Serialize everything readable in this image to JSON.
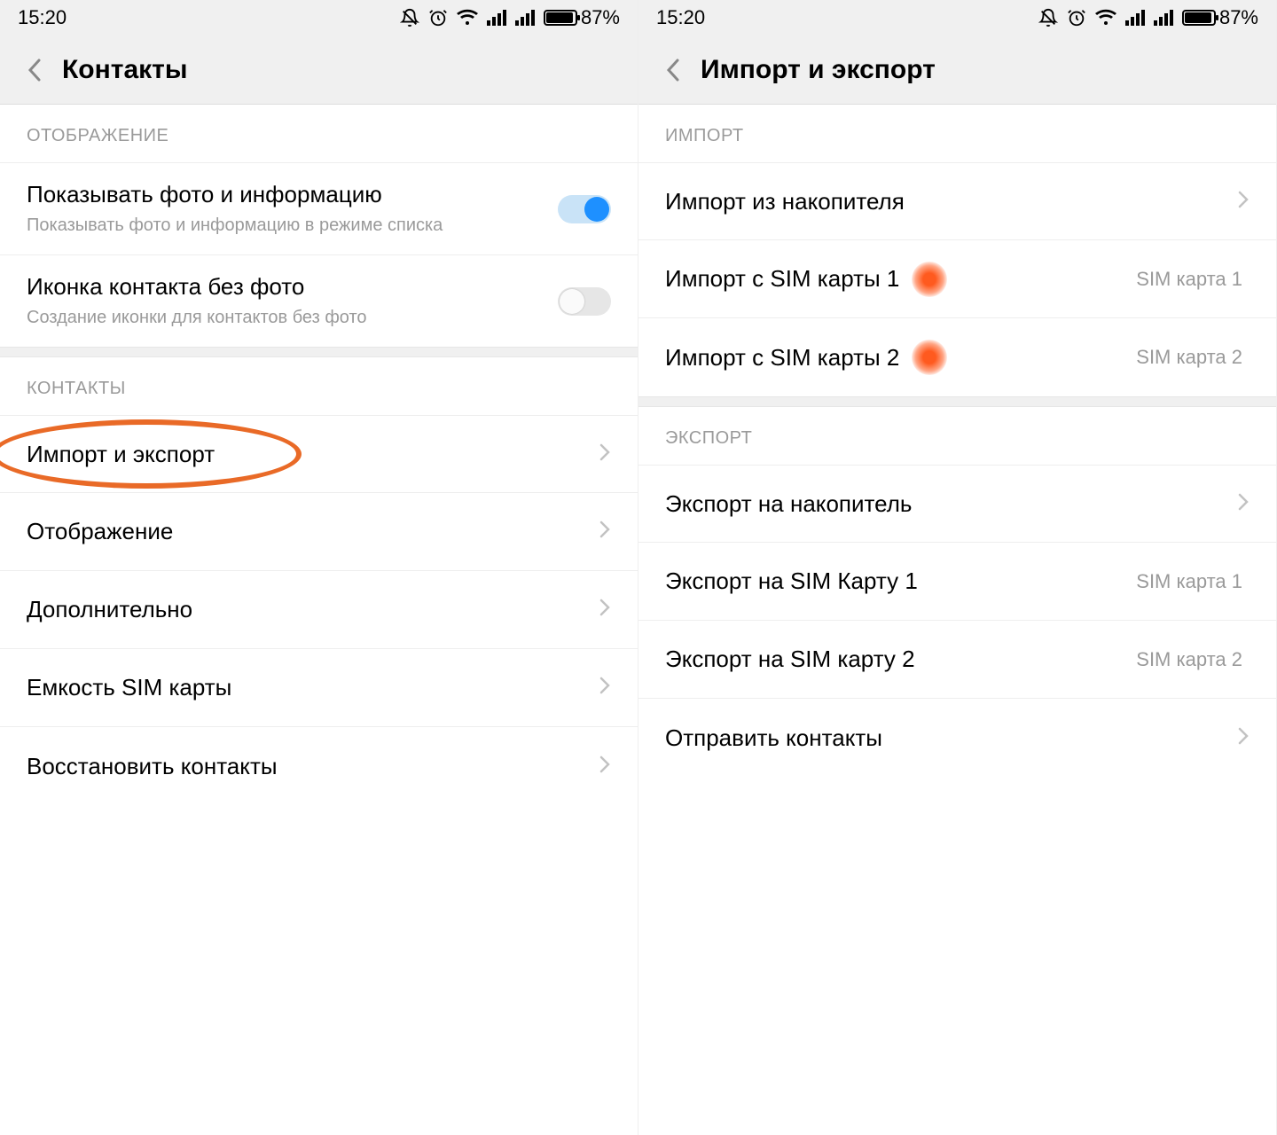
{
  "status": {
    "time": "15:20",
    "battery": "87%"
  },
  "left": {
    "title": "Контакты",
    "section_display": "ОТОБРАЖЕНИЕ",
    "row_photo_title": "Показывать фото и информацию",
    "row_photo_sub": "Показывать фото и информацию в режиме списка",
    "row_icon_title": "Иконка контакта без фото",
    "row_icon_sub": "Создание иконки для контактов без фото",
    "section_contacts": "КОНТАКТЫ",
    "row_import_export": "Импорт и экспорт",
    "row_display": "Отображение",
    "row_additional": "Дополнительно",
    "row_sim_capacity": "Емкость SIM карты",
    "row_restore": "Восстановить контакты"
  },
  "right": {
    "title": "Импорт и экспорт",
    "section_import": "ИМПОРТ",
    "row_import_storage": "Импорт из накопителя",
    "row_import_sim1": "Импорт с SIM карты 1",
    "row_import_sim1_val": "SIM карта 1",
    "row_import_sim2": "Импорт с SIM карты 2",
    "row_import_sim2_val": "SIM карта 2",
    "section_export": "ЭКСПОРТ",
    "row_export_storage": "Экспорт на накопитель",
    "row_export_sim1": "Экспорт на SIM Карту 1",
    "row_export_sim1_val": "SIM карта 1",
    "row_export_sim2": "Экспорт на SIM карту 2",
    "row_export_sim2_val": "SIM карта 2",
    "row_send": "Отправить контакты"
  }
}
